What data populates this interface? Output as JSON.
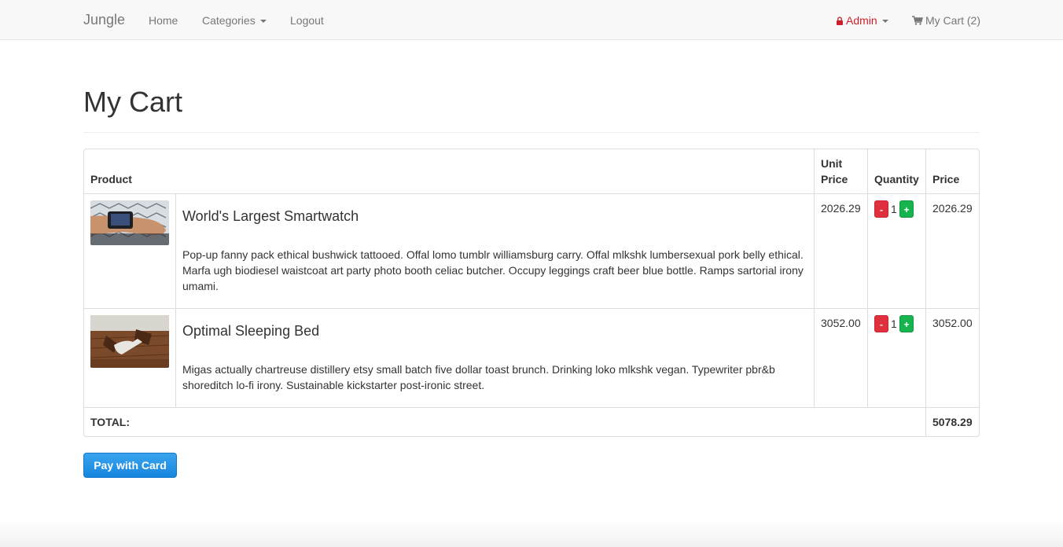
{
  "nav": {
    "brand": "Jungle",
    "home": "Home",
    "categories": "Categories",
    "logout": "Logout",
    "admin": "Admin",
    "cart": "My Cart (2)"
  },
  "page": {
    "title": "My Cart"
  },
  "table": {
    "headers": {
      "product": "Product",
      "unit_price_1": "Unit",
      "unit_price_2": "Price",
      "quantity": "Quantity",
      "price": "Price"
    },
    "rows": [
      {
        "name": "World's Largest Smartwatch",
        "description": "Pop-up fanny pack ethical bushwick tattooed. Offal lomo tumblr williamsburg carry. Offal mlkshk lumbersexual pork belly ethical. Marfa ugh biodiesel waistcoat art party photo booth celiac butcher. Occupy leggings craft beer blue bottle. Ramps sartorial irony umami.",
        "unit_price": "2026.29",
        "quantity": "1",
        "price": "2026.29",
        "minus": "-",
        "plus": "+"
      },
      {
        "name": "Optimal Sleeping Bed",
        "description": "Migas actually chartreuse distillery etsy small batch five dollar toast brunch. Drinking loko mlkshk vegan. Typewriter pbr&b shoreditch lo-fi irony. Sustainable kickstarter post-ironic street.",
        "unit_price": "3052.00",
        "quantity": "1",
        "price": "3052.00",
        "minus": "-",
        "plus": "+"
      }
    ],
    "total_label": "TOTAL:",
    "total_value": "5078.29"
  },
  "actions": {
    "pay": "Pay with Card"
  },
  "colors": {
    "admin": "#cc1f2d",
    "minus": "#e0303f",
    "plus": "#17b34e",
    "pay": "#1586de"
  }
}
